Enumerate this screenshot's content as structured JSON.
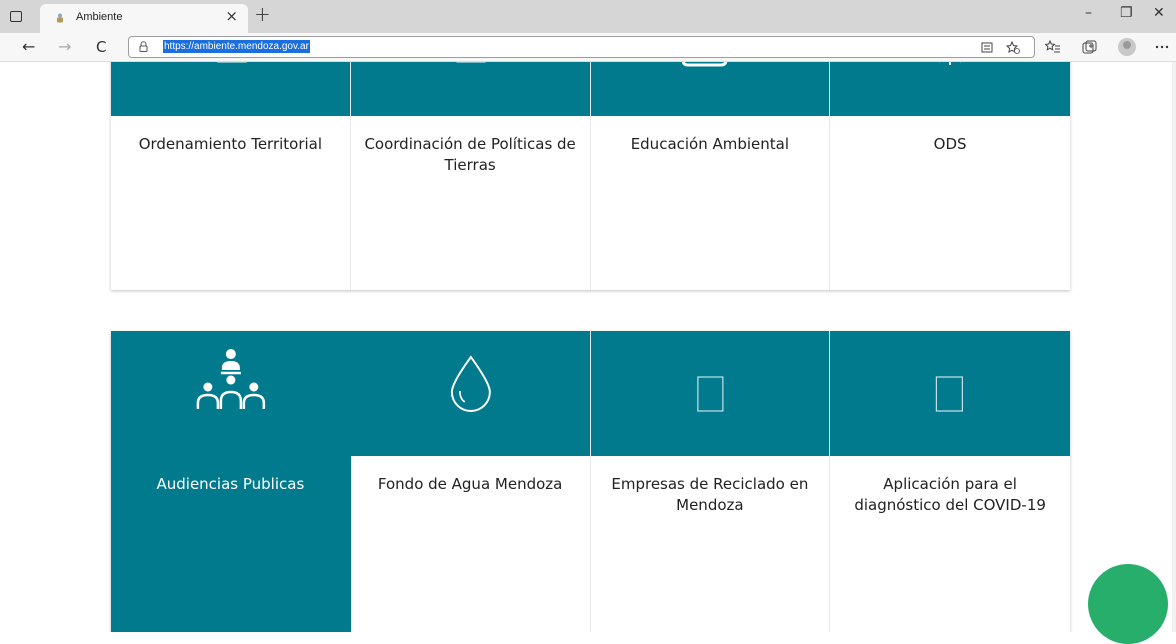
{
  "browser": {
    "tab_title": "Ambiente",
    "tab_close": "×",
    "new_tab": "+",
    "url": "https://ambiente.mendoza.gov.ar",
    "controls": {
      "minimize": "–",
      "restore": "❐",
      "close": "✕"
    },
    "nav": {
      "back": "←",
      "forward": "→",
      "reload": "C"
    },
    "icons": [
      "tab-actions-icon",
      "favicon-icon",
      "lock-icon",
      "read-aloud-icon",
      "favorite-add-icon",
      "favorites-icon",
      "collections-icon",
      "profile-icon",
      "more-icon"
    ]
  },
  "row1": [
    {
      "title": "Ordenamiento Territorial",
      "icon": "square-outline-icon"
    },
    {
      "title": "Coordinación de Políticas de Tierras",
      "icon": "square-outline-icon"
    },
    {
      "title": "Educación Ambiental",
      "icon": "board-icon"
    },
    {
      "title": "ODS",
      "icon": "globe-icon"
    }
  ],
  "row2": [
    {
      "title": "Audiencias Publicas",
      "icon": "audience-icon",
      "active": true
    },
    {
      "title": "Fondo de Agua Mendoza",
      "icon": "water-drop-icon",
      "active": false
    },
    {
      "title": "Empresas de Reciclado en Mendoza",
      "icon": "square-outline-icon",
      "active": false
    },
    {
      "title": "Aplicación para el diagnóstico del COVID-19",
      "icon": "square-outline-icon",
      "active": false
    }
  ],
  "colors": {
    "teal": "#007a8c",
    "chrome": "#d6d6d6",
    "url_highlight": "#1a6ede",
    "fab": "#27ae6b"
  }
}
